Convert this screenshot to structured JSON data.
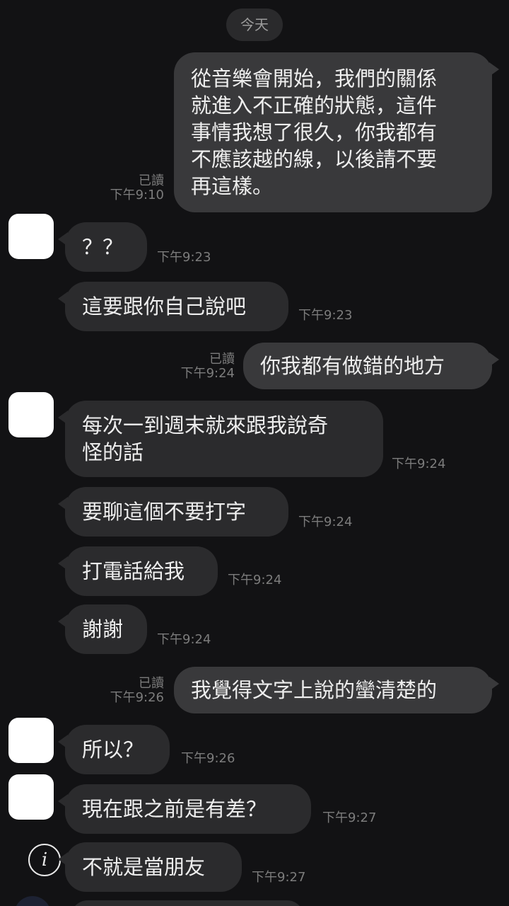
{
  "date_divider": "今天",
  "read_label": "已讀",
  "info_icon_glyph": "i",
  "colors": {
    "background": "#121214",
    "incoming_bubble": "#2b2b2d",
    "outgoing_bubble": "#39393b",
    "meta_text": "#7c7c7c",
    "avatar": "#ffffff"
  },
  "messages": [
    {
      "from": "me",
      "text": "從音樂會開始，我們的關係\n就進入不正確的狀態，這件\n事情我想了很久，你我都有\n不應該越的線，以後請不要\n再這樣。",
      "time": "下午9:10",
      "read": true
    },
    {
      "from": "them",
      "text": "？？",
      "time": "下午9:23"
    },
    {
      "from": "them",
      "text": "這要跟你自己說吧",
      "time": "下午9:23"
    },
    {
      "from": "me",
      "text": "你我都有做錯的地方",
      "time": "下午9:24",
      "read": true
    },
    {
      "from": "them",
      "text": "每次一到週末就來跟我說奇\n怪的話",
      "time": "下午9:24"
    },
    {
      "from": "them",
      "text": "要聊這個不要打字",
      "time": "下午9:24"
    },
    {
      "from": "them",
      "text": "打電話給我",
      "time": "下午9:24"
    },
    {
      "from": "them",
      "text": "謝謝",
      "time": "下午9:24"
    },
    {
      "from": "me",
      "text": "我覺得文字上說的蠻清楚的",
      "time": "下午9:26",
      "read": true
    },
    {
      "from": "them",
      "text": "所以？",
      "time": "下午9:26"
    },
    {
      "from": "them",
      "text": "現在跟之前是有差？",
      "time": "下午9:27"
    },
    {
      "from": "them",
      "text": "不就是當朋友",
      "time": "下午9:27"
    }
  ]
}
